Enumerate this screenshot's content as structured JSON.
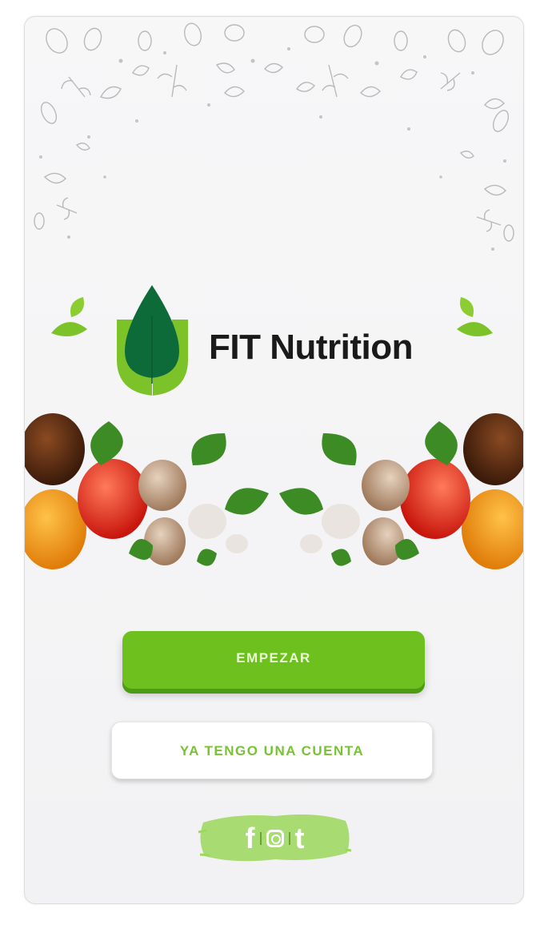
{
  "app": {
    "brand_name": "FIT Nutrition",
    "brand_color": "#6ec01e",
    "logo_icon": "leaf-drop-logo-icon",
    "hero_image": "vegetables-banner"
  },
  "actions": {
    "start_label": "EMPEZAR",
    "login_label": "YA TENGO UNA CUENTA"
  },
  "social": {
    "items": [
      {
        "icon": "facebook-icon",
        "glyph": "f"
      },
      {
        "icon": "instagram-icon",
        "glyph": ""
      },
      {
        "icon": "tumblr-icon",
        "glyph": "t"
      }
    ]
  }
}
